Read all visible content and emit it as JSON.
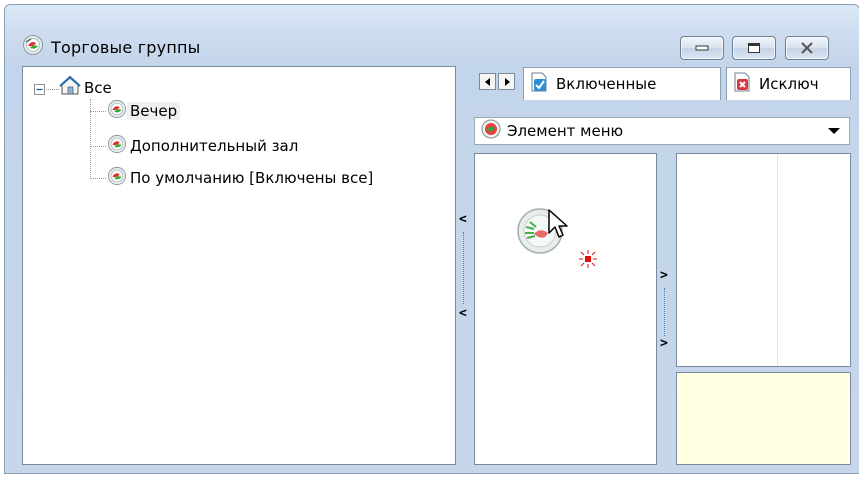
{
  "window": {
    "title": "Торговые группы",
    "title_icon": "menu-dish-icon",
    "controls": [
      "minimize-icon",
      "maximize-icon",
      "close-icon"
    ]
  },
  "tree": {
    "root": {
      "label": "Все",
      "icon": "house-icon",
      "expanded": true
    },
    "children": [
      {
        "label": "Вечер",
        "icon": "menu-dish-icon",
        "selected": true
      },
      {
        "label": "Дополнительный зал",
        "icon": "menu-dish-icon",
        "selected": false
      },
      {
        "label": "По умолчанию [Включены все]",
        "icon": "menu-dish-icon",
        "selected": false
      }
    ]
  },
  "splitter": {
    "left_arrows": [
      "<",
      "<"
    ],
    "right_arrows": [
      ">",
      ">"
    ]
  },
  "tabs": {
    "items": [
      {
        "label": "Включенные",
        "icon": "checked-document-icon"
      },
      {
        "label": "Исключ",
        "icon": "excluded-document-icon"
      }
    ]
  },
  "dropdown": {
    "selected": "Элемент меню",
    "icon": "menu-item-icon"
  },
  "colors": {
    "note_background": "#ffffe1",
    "frame": "#c6d7eb"
  }
}
